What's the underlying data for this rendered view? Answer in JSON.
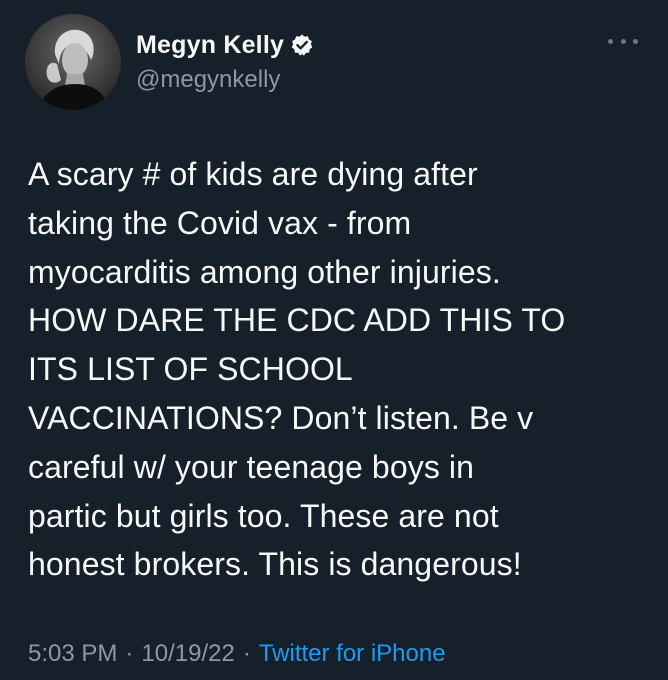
{
  "author": {
    "display_name": "Megyn Kelly",
    "handle": "@megynkelly",
    "verified": true,
    "avatar_icon": "profile-photo"
  },
  "tweet": {
    "text": "A scary # of kids are dying after\ntaking the Covid vax - from\nmyocarditis among other injuries.\nHOW DARE THE CDC ADD THIS TO\nITS LIST OF SCHOOL\nVACCINATIONS? Don’t listen. Be v\ncareful w/ your teenage boys in\npartic but girls too. These are not\nhonest brokers. This is dangerous!",
    "time": "5:03 PM",
    "date": "10/19/22",
    "separator": "·",
    "source": "Twitter for iPhone"
  },
  "colors": {
    "background": "#15202b",
    "text": "#f7f9f9",
    "muted": "#8b98a5",
    "accent": "#1d9bf0"
  },
  "icons": {
    "verified": "verified-badge-icon",
    "more": "more-options-icon"
  }
}
